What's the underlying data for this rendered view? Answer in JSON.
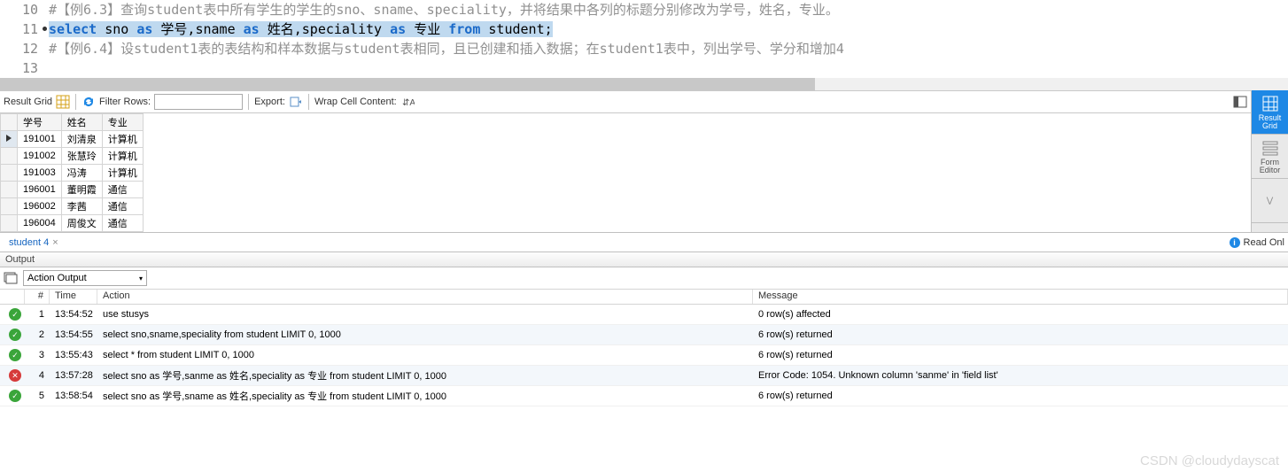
{
  "editor": {
    "lines": [
      {
        "num": "10",
        "marker": false,
        "tokens": [
          {
            "t": "comment",
            "v": "#【例6.3】查询student表中所有学生的学生的sno、sname、speciality，并将结果中各列的标题分别修改为学号，姓名，专业。"
          }
        ]
      },
      {
        "num": "11",
        "marker": true,
        "selected": true,
        "tokens": [
          {
            "t": "kw",
            "v": "select"
          },
          {
            "t": "p",
            "v": " sno "
          },
          {
            "t": "kw",
            "v": "as"
          },
          {
            "t": "p",
            "v": " 学号,sname "
          },
          {
            "t": "kw",
            "v": "as"
          },
          {
            "t": "p",
            "v": " 姓名,speciality "
          },
          {
            "t": "kw",
            "v": "as"
          },
          {
            "t": "p",
            "v": " 专业 "
          },
          {
            "t": "kw",
            "v": "from"
          },
          {
            "t": "p",
            "v": " student;"
          }
        ]
      },
      {
        "num": "12",
        "marker": false,
        "tokens": [
          {
            "t": "comment",
            "v": "#【例6.4】设student1表的表结构和样本数据与student表相同，且已创建和插入数据；在student1表中，列出学号、学分和增加4"
          }
        ]
      },
      {
        "num": "13",
        "marker": false,
        "tokens": []
      }
    ]
  },
  "toolbar": {
    "result_grid": "Result Grid",
    "filter_rows": "Filter Rows:",
    "filter_value": "",
    "export_label": "Export:",
    "wrap_label": "Wrap Cell Content:"
  },
  "grid": {
    "headers": [
      "学号",
      "姓名",
      "专业"
    ],
    "rows": [
      [
        "191001",
        "刘清泉",
        "计算机"
      ],
      [
        "191002",
        "张慧玲",
        "计算机"
      ],
      [
        "191003",
        "冯涛",
        "计算机"
      ],
      [
        "196001",
        "董明霞",
        "通信"
      ],
      [
        "196002",
        "李茜",
        "通信"
      ],
      [
        "196004",
        "周俊文",
        "通信"
      ]
    ],
    "selected_row": 0
  },
  "right_tabs": {
    "result_grid": "Result Grid",
    "form_editor": "Form Editor"
  },
  "tab": {
    "name": "student 4"
  },
  "readonly": "Read Onl",
  "output": {
    "title": "Output",
    "selector": "Action Output",
    "col_num": "#",
    "col_time": "Time",
    "col_action": "Action",
    "col_msg": "Message",
    "rows": [
      {
        "status": "ok",
        "num": "1",
        "time": "13:54:52",
        "action": "use stusys",
        "msg": "0 row(s) affected"
      },
      {
        "status": "ok",
        "num": "2",
        "time": "13:54:55",
        "action": "select sno,sname,speciality from student LIMIT 0, 1000",
        "msg": "6 row(s) returned"
      },
      {
        "status": "ok",
        "num": "3",
        "time": "13:55:43",
        "action": "select * from student LIMIT 0, 1000",
        "msg": "6 row(s) returned"
      },
      {
        "status": "err",
        "num": "4",
        "time": "13:57:28",
        "action": "select sno as 学号,sanme as 姓名,speciality as 专业 from student LIMIT 0, 1000",
        "msg": "Error Code: 1054. Unknown column 'sanme' in 'field list'"
      },
      {
        "status": "ok",
        "num": "5",
        "time": "13:58:54",
        "action": "select sno as 学号,sname as 姓名,speciality as 专业 from student LIMIT 0, 1000",
        "msg": "6 row(s) returned"
      }
    ]
  },
  "watermark": "CSDN @cloudydayscat"
}
